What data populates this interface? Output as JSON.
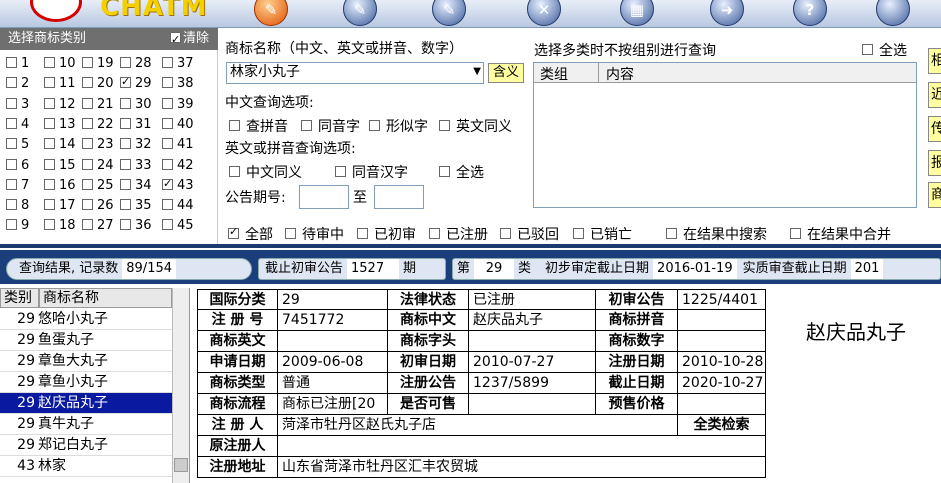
{
  "toolbar": {
    "logo": "CHATM",
    "icons": [
      {
        "name": "pencil-active-icon",
        "glyph": "✎"
      },
      {
        "name": "pencil-icon",
        "glyph": "✎"
      },
      {
        "name": "edit-icon",
        "glyph": "✎"
      },
      {
        "name": "tools-icon",
        "glyph": "✕"
      },
      {
        "name": "ruler-icon",
        "glyph": "▦"
      },
      {
        "name": "arrow-icon",
        "glyph": "➜"
      },
      {
        "name": "help-icon",
        "glyph": "?"
      },
      {
        "name": "ball-icon",
        "glyph": ""
      }
    ]
  },
  "class_panel": {
    "title": "选择商标类别",
    "clear_label": "清除",
    "columns": [
      [
        "1",
        "2",
        "3",
        "4",
        "5",
        "6",
        "7",
        "8",
        "9"
      ],
      [
        "10",
        "11",
        "12",
        "13",
        "14",
        "15",
        "16",
        "17",
        "18"
      ],
      [
        "19",
        "20",
        "21",
        "22",
        "23",
        "24",
        "25",
        "26",
        "27"
      ],
      [
        "28",
        "29",
        "30",
        "31",
        "32",
        "33",
        "34",
        "35",
        "36"
      ],
      [
        "37",
        "38",
        "39",
        "40",
        "41",
        "42",
        "43",
        "44",
        "45"
      ]
    ],
    "checked": [
      "29",
      "43"
    ]
  },
  "search": {
    "name_label": "商标名称（中文、英文或拼音、数字）",
    "name_value": "林家小丸子",
    "contain_button": "含义",
    "cn_options_label": "中文查询选项:",
    "cn_options": [
      "查拼音",
      "同音字",
      "形似字",
      "英文同义"
    ],
    "en_options_label": "英文或拼音查询选项:",
    "en_options": [
      "中文同义",
      "同音汉字",
      "全选"
    ],
    "pub_label": "公告期号:",
    "to_label": "至",
    "status_options": [
      "全部",
      "待审中",
      "已初审",
      "已注册",
      "已驳回",
      "已销亡"
    ],
    "status_checked": "全部",
    "result_options": [
      "在结果中搜索",
      "在结果中合并"
    ]
  },
  "multi_class": {
    "title": "选择多类时不按组别进行查询",
    "select_all": "全选",
    "col_group": "类组",
    "col_content": "内容"
  },
  "side_buttons": [
    "相",
    "近",
    "传",
    "报",
    "商"
  ],
  "results_bar": {
    "count_label": "查询结果, 记录数",
    "count_value": "89/154",
    "deadline_label": "截止初审公告",
    "deadline_value": "1527",
    "deadline_unit": "期",
    "class_prefix": "第",
    "class_value": "29",
    "class_suffix": "类",
    "prelim_label": "初步审定截止日期",
    "prelim_value": "2016-01-19",
    "actual_label": "实质审查截止日期",
    "actual_value": "201"
  },
  "list": {
    "col_class": "类别",
    "col_name": "商标名称",
    "rows": [
      {
        "cls": "29",
        "name": "悠哈小丸子"
      },
      {
        "cls": "29",
        "name": "鱼蛋丸子"
      },
      {
        "cls": "29",
        "name": "章鱼大丸子"
      },
      {
        "cls": "29",
        "name": "章鱼小丸子"
      },
      {
        "cls": "29",
        "name": "赵庆品丸子",
        "selected": true
      },
      {
        "cls": "29",
        "name": "真牛丸子"
      },
      {
        "cls": "29",
        "name": "郑记白丸子"
      },
      {
        "cls": "43",
        "name": "林家"
      }
    ]
  },
  "detail": {
    "rows": [
      [
        "国际分类",
        "29",
        "法律状态",
        "已注册",
        "初审公告",
        "1225/4401"
      ],
      [
        "注 册 号",
        "7451772",
        "商标中文",
        "赵庆品丸子",
        "商标拼音",
        ""
      ],
      [
        "商标英文",
        "",
        "商标字头",
        "",
        "商标数字",
        ""
      ],
      [
        "申请日期",
        "2009-06-08",
        "初审日期",
        "2010-07-27",
        "注册日期",
        "2010-10-28"
      ],
      [
        "商标类型",
        "普通",
        "注册公告",
        "1237/5899",
        "截止日期",
        "2020-10-27"
      ],
      [
        "商标流程",
        "商标已注册[20",
        "是否可售",
        "",
        "预售价格",
        ""
      ]
    ],
    "registrant_label": "注 册 人",
    "registrant_value": "菏泽市牡丹区赵氏丸子店",
    "all_class_search": "全类检索",
    "orig_label": "原注册人",
    "orig_value": "",
    "address_label": "注册地址",
    "address_value": "山东省菏泽市牡丹区汇丰农贸城"
  },
  "preview": {
    "text": "赵庆品丸子"
  }
}
